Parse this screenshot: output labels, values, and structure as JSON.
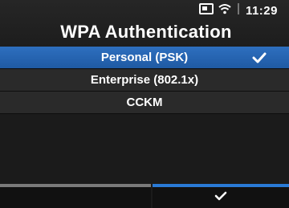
{
  "status": {
    "time": "11:29",
    "icons": [
      "sd-card-icon",
      "wifi-icon",
      "signal-icon"
    ]
  },
  "header": {
    "title": "WPA Authentication"
  },
  "options": [
    {
      "label": "Personal (PSK)",
      "selected": true
    },
    {
      "label": "Enterprise (802.1x)",
      "selected": false
    },
    {
      "label": "CCKM",
      "selected": false
    }
  ],
  "footer": {
    "left_label": "",
    "right_icon": "check-icon"
  },
  "colors": {
    "accent": "#2a7ad6",
    "selected_row": "#2566b5",
    "row_bg": "#2a2a2a"
  }
}
